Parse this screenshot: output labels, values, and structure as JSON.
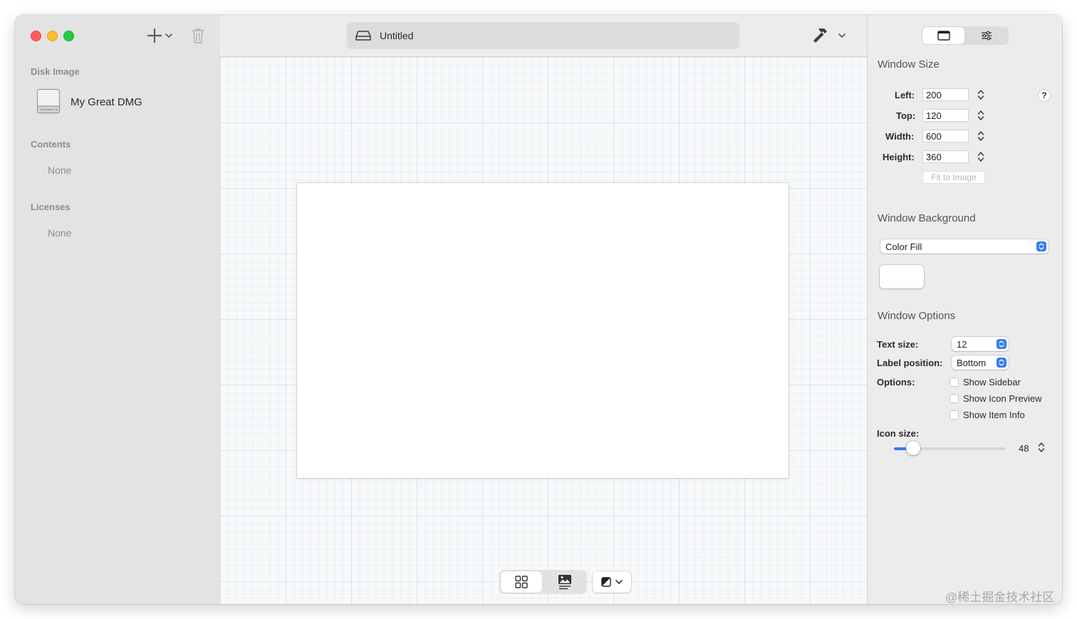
{
  "window": {
    "title": "Untitled"
  },
  "sidebar": {
    "disk_image_title": "Disk Image",
    "disk_name": "My Great DMG",
    "contents_title": "Contents",
    "contents_empty": "None",
    "licenses_title": "Licenses",
    "licenses_empty": "None"
  },
  "toolbar": {
    "add_icon": "plus-icon",
    "trash_icon": "trash-icon",
    "build_icon": "hammer-icon"
  },
  "inspector": {
    "window_size": {
      "title": "Window Size",
      "left_label": "Left:",
      "left_value": "200",
      "top_label": "Top:",
      "top_value": "120",
      "width_label": "Width:",
      "width_value": "600",
      "height_label": "Height:",
      "height_value": "360",
      "help": "?",
      "fit_button": "Fit to Image"
    },
    "window_background": {
      "title": "Window Background",
      "fill_type": "Color Fill",
      "color": "#ffffff"
    },
    "window_options": {
      "title": "Window Options",
      "text_size_label": "Text size:",
      "text_size_value": "12",
      "label_position_label": "Label position:",
      "label_position_value": "Bottom",
      "options_label": "Options:",
      "show_sidebar": "Show Sidebar",
      "show_icon_preview": "Show Icon Preview",
      "show_item_info": "Show Item Info",
      "icon_size_label": "Icon size:",
      "icon_size_value": "48",
      "icon_size_fraction": 0.17
    }
  },
  "watermark": "@稀土掘金技术社区",
  "colors": {
    "accent": "#2f7cf6",
    "sidebar_bg": "#e3e3e3",
    "close": "#fe5f57",
    "minimize": "#febc2e",
    "zoom": "#28c840"
  }
}
